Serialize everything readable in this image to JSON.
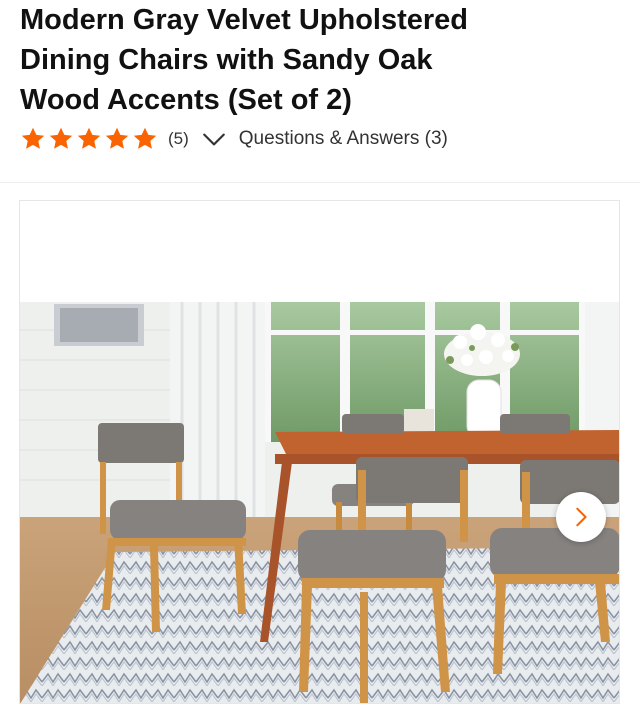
{
  "product": {
    "title_line1": "Modern Gray Velvet Upholstered",
    "title_line2": "Dining Chairs with Sandy Oak",
    "title_line3": "Wood Accents (Set of 2)"
  },
  "rating": {
    "stars": 5,
    "max_stars": 5,
    "review_count_label": "(5)",
    "star_color": "#f96302"
  },
  "qa": {
    "label": "Questions & Answers (3)"
  },
  "gallery": {
    "next_icon": "chevron-right-icon",
    "accent_color": "#f96302",
    "image_icon": "dining-set-photo"
  }
}
